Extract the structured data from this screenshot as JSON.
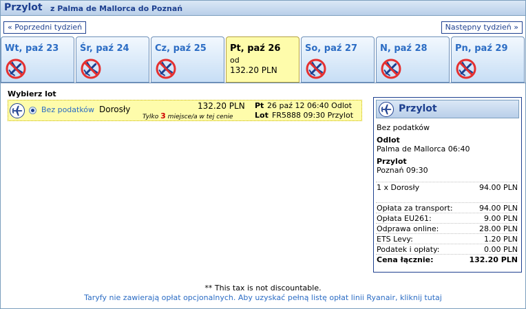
{
  "header": {
    "title": "Przylot",
    "route": "z Palma de Mallorca do Poznań"
  },
  "nav": {
    "prev_label": "« Poprzedni tydzień",
    "next_label": "Następny tydzień »"
  },
  "tabs": [
    {
      "label": "Wt, paź 23",
      "available": false
    },
    {
      "label": "Śr, paź 24",
      "available": false
    },
    {
      "label": "Cz, paź 25",
      "available": false
    },
    {
      "label": "Pt, paź 26",
      "available": true,
      "selected": true,
      "from_label": "od",
      "price": "132.20 PLN"
    },
    {
      "label": "So, paź 27",
      "available": false
    },
    {
      "label": "N, paź 28",
      "available": false
    },
    {
      "label": "Pn, paź 29",
      "available": false
    }
  ],
  "flight_select": {
    "label": "Wybierz lot",
    "fare_name": "Bez podatków",
    "passenger": "Dorosły",
    "price": "132.20 PLN",
    "seats_prefix": "Tylko",
    "seats_count": "3",
    "seats_suffix": "miejsce/a w tej cenie",
    "depart_day": "Pt",
    "depart_info": "26 paź 12 06:40 Odlot",
    "flight_label": "Lot",
    "flight_info": "FR5888   09:30 Przylot"
  },
  "summary": {
    "title": "Przylot",
    "fare_name": "Bez podatków",
    "depart_label": "Odlot",
    "depart_value": "Palma de Mallorca 06:40",
    "arrive_label": "Przylot",
    "arrive_value": "Poznań 09:30",
    "passenger_line": {
      "label": "1 x Dorosły",
      "value": "94.00 PLN"
    },
    "fees": [
      {
        "label": "Opłata za transport:",
        "value": "94.00 PLN"
      },
      {
        "label": "Opłata EU261:",
        "value": "9.00 PLN"
      },
      {
        "label": "Odprawa online:",
        "value": "28.00 PLN"
      },
      {
        "label": "ETS Levy:",
        "value": "1.20 PLN"
      },
      {
        "label": "Podatek i opłaty:",
        "value": "0.00 PLN"
      }
    ],
    "total": {
      "label": "Cena łącznie:",
      "value": "132.20 PLN"
    }
  },
  "footer": {
    "tax_note": "** This tax is not discountable.",
    "fees_link": "Taryfy nie zawierają opłat opcjonalnych. Aby uzyskać pełną listę opłat linii Ryanair, kliknij tutaj"
  },
  "colors": {
    "brand": "#1d3f8f",
    "link": "#2b6cc4",
    "selected": "#fefcab",
    "alert": "#d00000"
  }
}
